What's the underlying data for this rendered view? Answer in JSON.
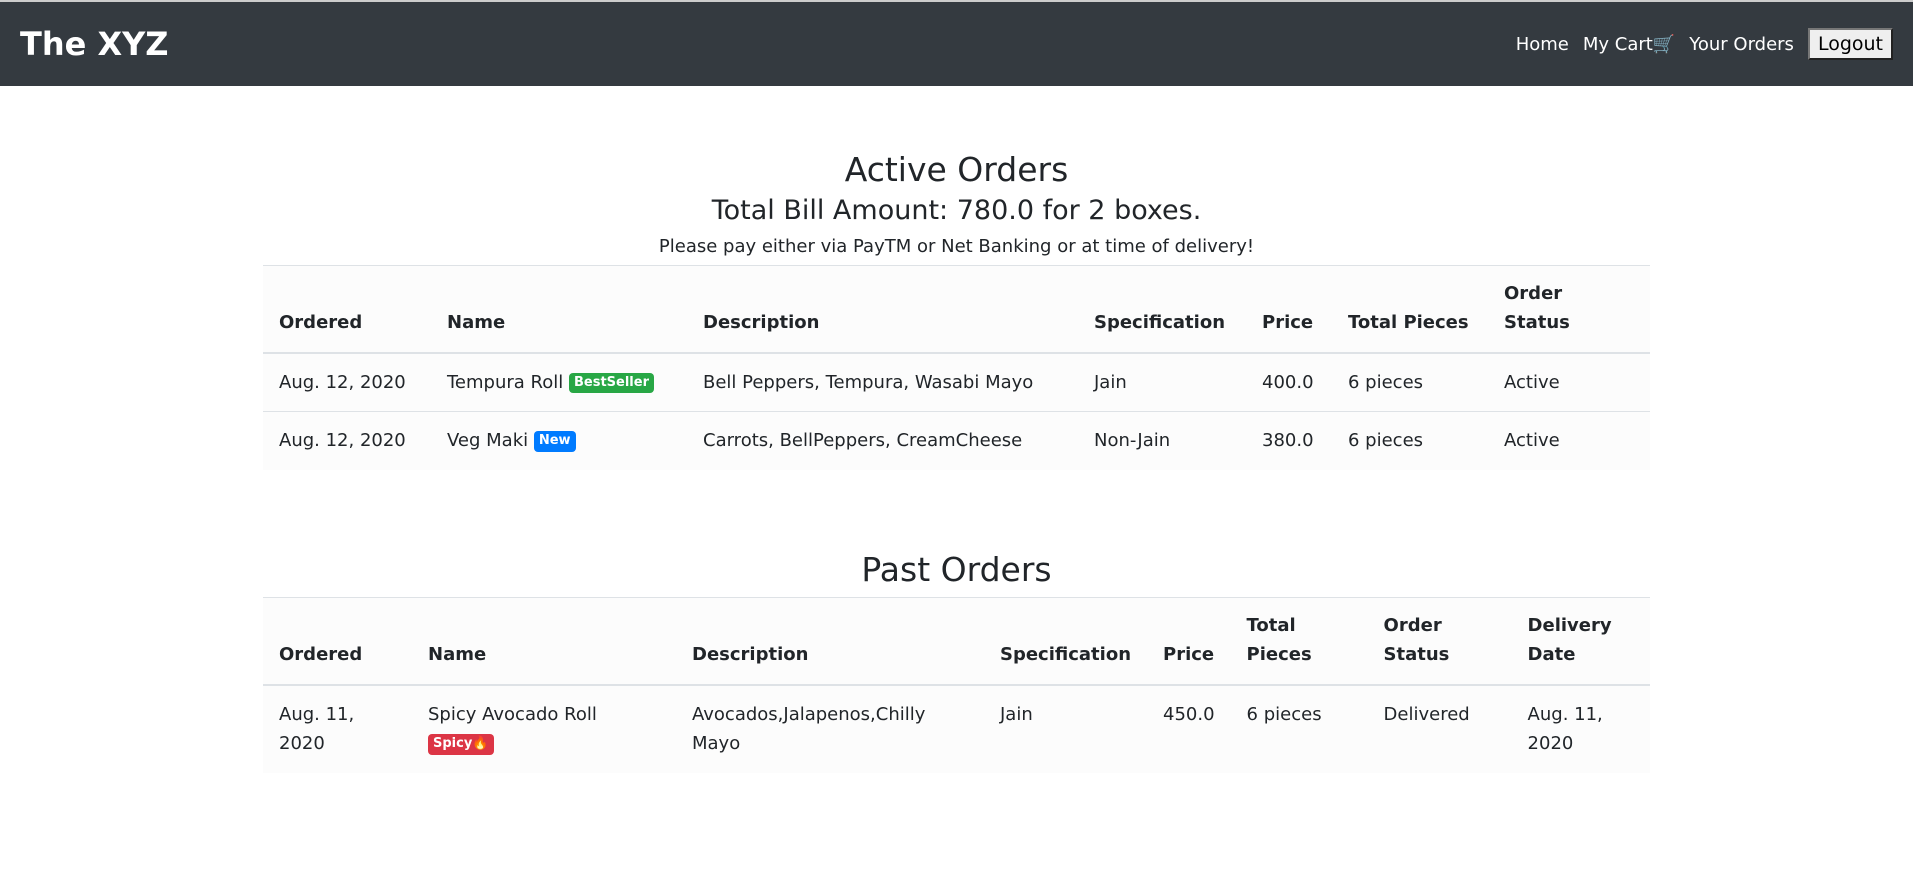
{
  "nav": {
    "brand": "The XYZ",
    "home": "Home",
    "cart": "My Cart",
    "cart_icon": "🛒",
    "orders": "Your Orders",
    "logout": "Logout"
  },
  "active": {
    "title": "Active Orders",
    "total": "Total Bill Amount: 780.0 for 2 boxes.",
    "note": "Please pay either via PayTM or Net Banking or at time of delivery!",
    "headers": [
      "Ordered",
      "Name",
      "Description",
      "Specification",
      "Price",
      "Total Pieces",
      "Order Status"
    ],
    "rows": [
      {
        "ordered": "Aug. 12, 2020",
        "name": "Tempura Roll",
        "badge": "BestSeller",
        "badge_color": "#28a745",
        "desc": "Bell Peppers, Tempura, Wasabi Mayo",
        "spec": "Jain",
        "price": "400.0",
        "pieces": "6 pieces",
        "status": "Active"
      },
      {
        "ordered": "Aug. 12, 2020",
        "name": "Veg Maki",
        "badge": "New",
        "badge_color": "#007bff",
        "desc": "Carrots, BellPeppers, CreamCheese",
        "spec": "Non-Jain",
        "price": "380.0",
        "pieces": "6 pieces",
        "status": "Active"
      }
    ]
  },
  "past": {
    "title": "Past Orders",
    "headers": [
      "Ordered",
      "Name",
      "Description",
      "Specification",
      "Price",
      "Total Pieces",
      "Order Status",
      "Delivery Date"
    ],
    "rows": [
      {
        "ordered": "Aug. 11, 2020",
        "name": "Spicy Avocado Roll",
        "badge": "Spicy🔥",
        "badge_color": "#dc3545",
        "desc": "Avocados,Jalapenos,Chilly Mayo",
        "spec": "Jain",
        "price": "450.0",
        "pieces": "6 pieces",
        "status": "Delivered",
        "delivery": "Aug. 11, 2020"
      }
    ]
  }
}
